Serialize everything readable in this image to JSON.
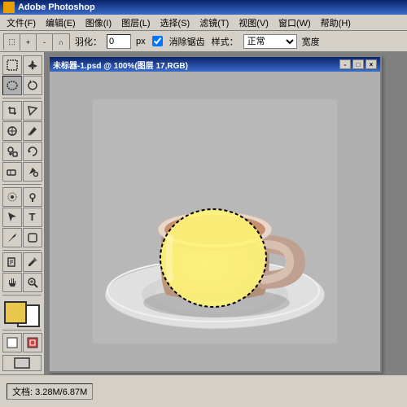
{
  "app": {
    "title": "Adobe Photoshop",
    "title_icon": "PS"
  },
  "menu": {
    "items": [
      "文件(F)",
      "编辑(E)",
      "图像(I)",
      "图层(L)",
      "选择(S)",
      "滤镜(T)",
      "视图(V)",
      "窗口(W)",
      "帮助(H)"
    ]
  },
  "options_bar": {
    "feather_label": "羽化：",
    "feather_value": "0",
    "feather_unit": "px",
    "antialias_label": "消除锯齿",
    "style_label": "样式：",
    "style_value": "正常",
    "width_label": "宽度"
  },
  "document": {
    "title": "未标器-1.psd @ 100%(图层 17,RGB)",
    "controls": [
      "-",
      "□",
      "×"
    ]
  },
  "tools": {
    "rows": [
      [
        "↖",
        "✂"
      ],
      [
        "⬚",
        "⬚"
      ],
      [
        "✒",
        "✒"
      ],
      [
        "✒",
        "S"
      ],
      [
        "⬚",
        "✒"
      ],
      [
        "⬚",
        "🔍"
      ],
      [
        "⬚",
        "⬚"
      ],
      [
        "A",
        "T"
      ],
      [
        "☆",
        "⬚"
      ],
      [
        "✋",
        "🔍"
      ],
      [
        "↗",
        "⬚"
      ]
    ]
  },
  "status_bar": {
    "doc_info": "文档: 3.28M/6.87M"
  }
}
